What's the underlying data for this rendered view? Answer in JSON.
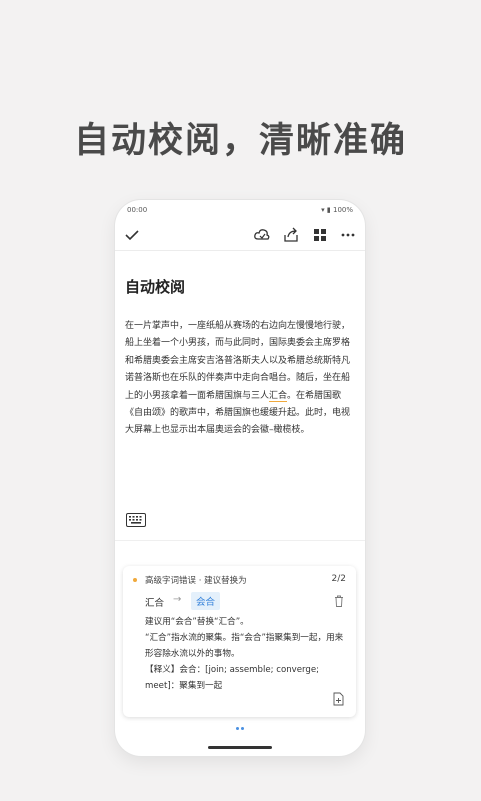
{
  "promo": {
    "headline": "自动校阅，清晰准确"
  },
  "status_bar": {
    "time": "00:00",
    "battery": "100%"
  },
  "toolbar": {
    "icons": [
      "check-icon",
      "cloud-sync-icon",
      "share-icon",
      "grid-icon",
      "more-icon"
    ]
  },
  "document": {
    "title": "自动校阅",
    "body_before_error": "在一片掌声中，一座纸船从赛场的右边向左慢慢地行驶，船上坐着一个小男孩，而与此同时，国际奥委会主席罗格和希腊奥委会主席安吉洛普洛斯夫人以及希腊总统斯特凡诺普洛斯也在乐队的伴奏声中走向合唱台。随后，坐在船上的小男孩拿着一面希腊国旗与三人",
    "error_word": "汇合",
    "body_after_error": "。在希腊国歌《自由颂》的歌声中，希腊国旗也缓缓升起。此时，电视大屏幕上也显示出本届奥运会的会徽–橄榄枝。"
  },
  "suggestion": {
    "type": "高级字词错误 · 建议替换为",
    "counter": "2/2",
    "original": "汇合",
    "arrow": "→",
    "replacement": "会合",
    "explanation_1": "建议用“会合”替换“汇合”。",
    "explanation_2": "“汇合”指水流的聚集。指“会合”指聚集到一起，用来形容除水流以外的事物。",
    "explanation_3": "【释义】会合：[join; assemble; converge; meet]：聚集到一起"
  },
  "colors": {
    "accent": "#2f7ed8",
    "warning": "#f0a93c",
    "background": "#f3f2f2"
  }
}
